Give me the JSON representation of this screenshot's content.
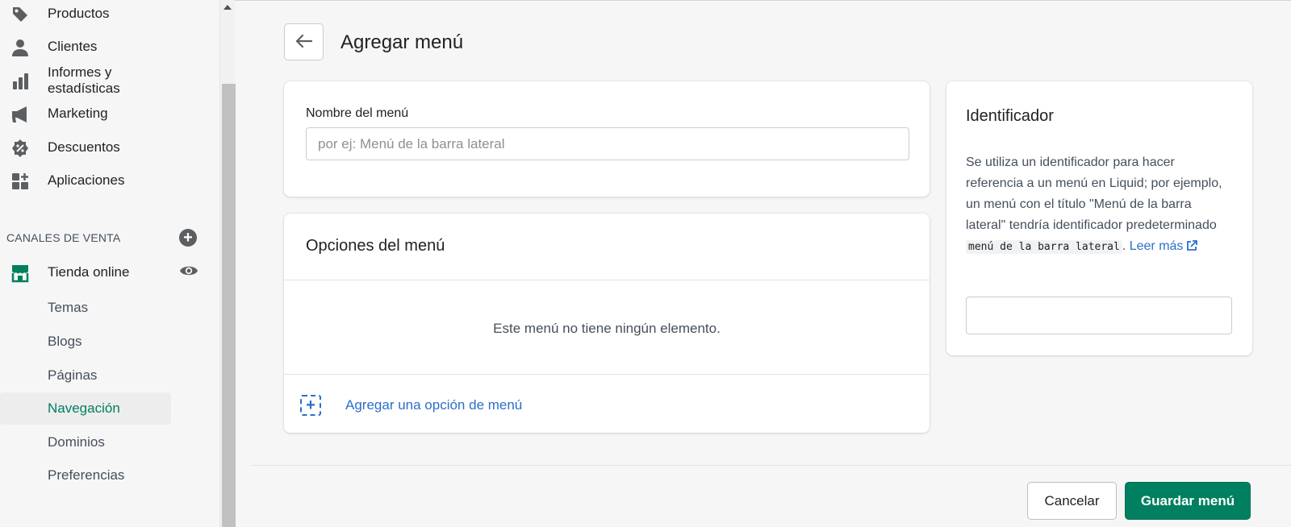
{
  "sidebar": {
    "items": [
      {
        "label": "Productos",
        "icon": "tag-icon"
      },
      {
        "label": "Clientes",
        "icon": "person-icon"
      },
      {
        "label": "Informes y estadísticas",
        "icon": "bar-chart-icon"
      },
      {
        "label": "Marketing",
        "icon": "megaphone-icon"
      },
      {
        "label": "Descuentos",
        "icon": "discount-icon"
      },
      {
        "label": "Aplicaciones",
        "icon": "apps-icon"
      }
    ],
    "sales_channels_heading": "CANALES DE VENTA",
    "online_store": {
      "label": "Tienda online",
      "icon": "store-icon"
    },
    "sub_items": [
      {
        "label": "Temas",
        "active": false
      },
      {
        "label": "Blogs",
        "active": false
      },
      {
        "label": "Páginas",
        "active": false
      },
      {
        "label": "Navegación",
        "active": true
      },
      {
        "label": "Dominios",
        "active": false
      },
      {
        "label": "Preferencias",
        "active": false
      }
    ]
  },
  "header": {
    "title": "Agregar menú"
  },
  "menu_name": {
    "label": "Nombre del menú",
    "placeholder": "por ej: Menú de la barra lateral",
    "value": ""
  },
  "menu_options": {
    "heading": "Opciones del menú",
    "empty_message": "Este menú no tiene ningún elemento.",
    "add_link": "Agregar una opción de menú"
  },
  "identifier": {
    "heading": "Identificador",
    "description_pre": "Se utiliza un identificador para hacer referencia a un menú en Liquid; por ejemplo, un menú con el título \"Menú de la barra lateral\" tendría identificador predeterminado ",
    "code": "menú de la barra lateral",
    "description_post": ". ",
    "learn_more": "Leer más",
    "value": ""
  },
  "footer": {
    "cancel_label": "Cancelar",
    "save_label": "Guardar menú"
  },
  "colors": {
    "accent": "#008060",
    "link": "#2c6ecb",
    "active_nav": "#007f5f"
  }
}
